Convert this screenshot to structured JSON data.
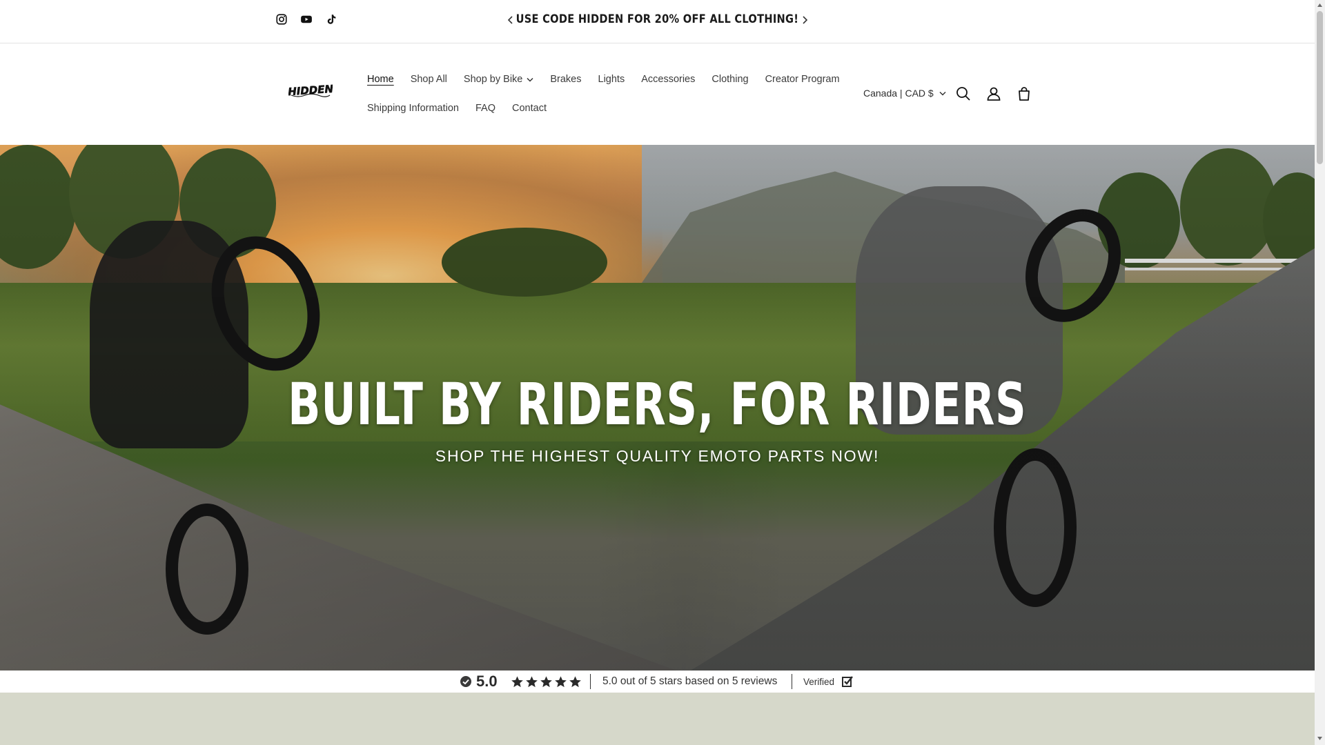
{
  "announcement": {
    "text": "USE CODE HIDDEN FOR 20% OFF ALL CLOTHING!",
    "social_icons": [
      "instagram-icon",
      "youtube-icon",
      "tiktok-icon"
    ]
  },
  "header": {
    "logo_text": "HIDDEN",
    "nav_row1": [
      {
        "label": "Home",
        "active": true
      },
      {
        "label": "Shop All"
      },
      {
        "label": "Shop by Bike",
        "has_dropdown": true
      },
      {
        "label": "Brakes"
      },
      {
        "label": "Lights"
      },
      {
        "label": "Accessories"
      },
      {
        "label": "Clothing"
      },
      {
        "label": "Creator Program"
      }
    ],
    "nav_row2": [
      {
        "label": "Shipping Information"
      },
      {
        "label": "FAQ"
      },
      {
        "label": "Contact"
      }
    ],
    "region_selector": "Canada | CAD $",
    "icons": [
      "search-icon",
      "account-icon",
      "cart-icon"
    ]
  },
  "hero": {
    "title": "BUILT BY RIDERS, FOR RIDERS",
    "subtitle": "SHOP THE HIGHEST QUALITY EMOTO PARTS NOW!"
  },
  "reviews": {
    "score": "5.0",
    "stars": 5,
    "summary": "5.0 out of 5 stars based on 5 reviews",
    "verified_label": "Verified"
  },
  "colors": {
    "accent_bg": "#d6d8ca",
    "text": "#121212",
    "hero_text": "#ffffff"
  }
}
